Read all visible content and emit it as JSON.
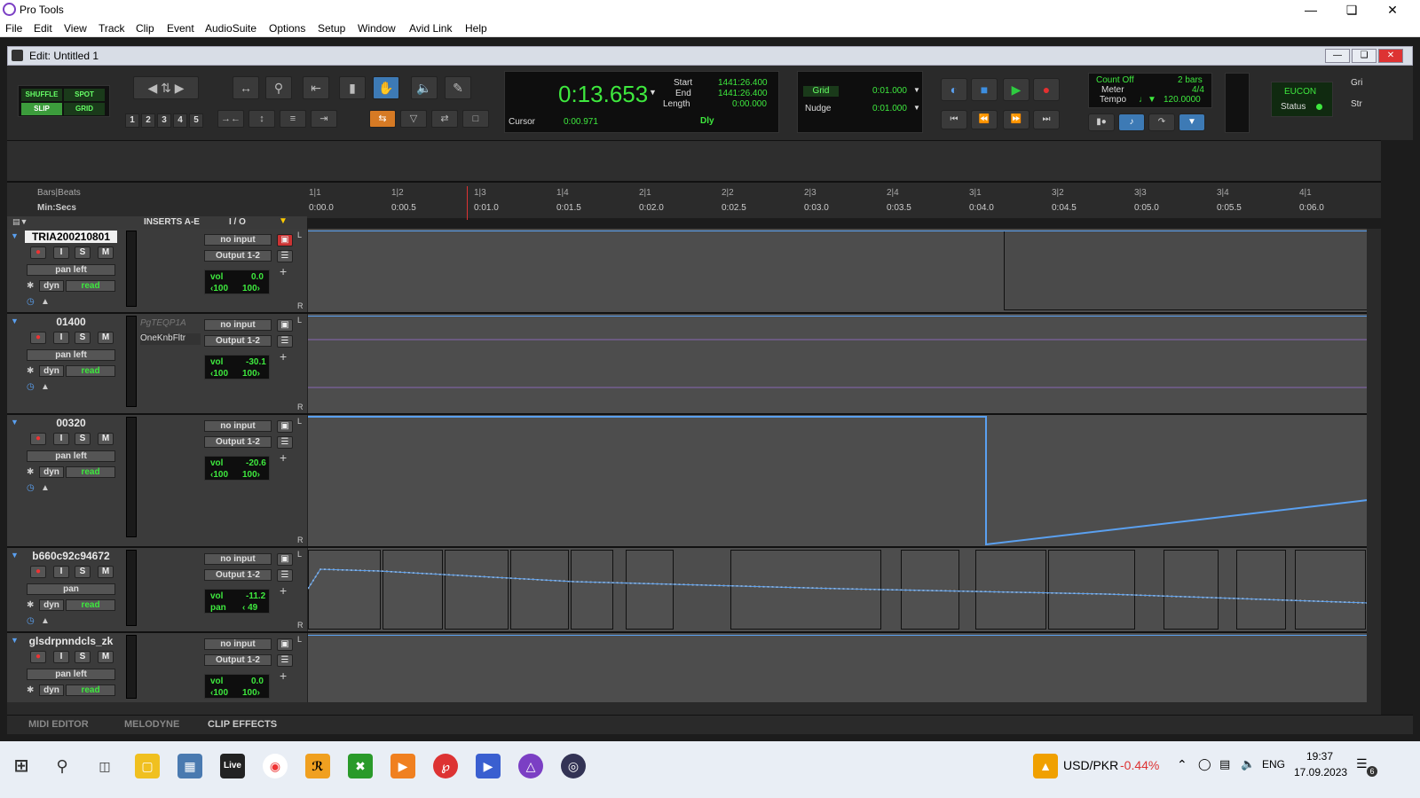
{
  "app": {
    "title": "Pro Tools"
  },
  "menu": [
    "File",
    "Edit",
    "View",
    "Track",
    "Clip",
    "Event",
    "AudioSuite",
    "Options",
    "Setup",
    "Window",
    "Avid Link",
    "Help"
  ],
  "edit_window": {
    "title": "Edit: Untitled 1"
  },
  "modes": {
    "shuffle": "SHUFFLE",
    "spot": "SPOT",
    "slip": "SLIP",
    "grid": "GRID"
  },
  "zoom_presets": [
    "1",
    "2",
    "3",
    "4",
    "5"
  ],
  "counter": {
    "main": "0:13.653",
    "start_label": "Start",
    "start": "1441:26.400",
    "end_label": "End",
    "end": "1441:26.400",
    "length_label": "Length",
    "length": "0:00.000",
    "cursor_label": "Cursor",
    "cursor": "0:00.971",
    "dly": "Dly"
  },
  "grid": {
    "grid_label": "Grid",
    "grid_value": "0:01.000",
    "nudge_label": "Nudge",
    "nudge_value": "0:01.000"
  },
  "countoff": {
    "label": "Count Off",
    "bars": "2 bars",
    "meter_label": "Meter",
    "meter": "4/4",
    "tempo_label": "Tempo",
    "tempo": "120.0000"
  },
  "eucon": {
    "label": "EUCON",
    "status": "Status"
  },
  "misc": {
    "gri": "Gri",
    "str": "Str"
  },
  "rulers": {
    "bars_label": "Bars|Beats",
    "min_label": "Min:Secs",
    "bars": [
      "1|1",
      "1|2",
      "1|3",
      "1|4",
      "2|1",
      "2|2",
      "2|3",
      "2|4",
      "3|1",
      "3|2",
      "3|3",
      "3|4",
      "4|1"
    ],
    "secs": [
      "0:00.0",
      "0:00.5",
      "0:01.0",
      "0:01.5",
      "0:02.0",
      "0:02.5",
      "0:03.0",
      "0:03.5",
      "0:04.0",
      "0:04.5",
      "0:05.0",
      "0:05.5",
      "0:06.0"
    ]
  },
  "columns": {
    "inserts": "INSERTS A-E",
    "io": "I / O"
  },
  "tracks": [
    {
      "name": "TRIA200210801",
      "insert1": "",
      "insert2": "",
      "input": "no input",
      "output": "Output 1-2",
      "pan_mode": "pan left",
      "dyn": "dyn",
      "auto": "read",
      "vol_label": "vol",
      "vol": "0.0",
      "p1": "‹100",
      "p2": "100›"
    },
    {
      "name": "01400",
      "insert1": "PgTEQP1A",
      "insert2": "OneKnbFltr",
      "input": "no input",
      "output": "Output 1-2",
      "pan_mode": "pan left",
      "dyn": "dyn",
      "auto": "read",
      "vol_label": "vol",
      "vol": "-30.1",
      "p1": "‹100",
      "p2": "100›"
    },
    {
      "name": "00320",
      "insert1": "",
      "insert2": "",
      "input": "no input",
      "output": "Output 1-2",
      "pan_mode": "pan left",
      "dyn": "dyn",
      "auto": "read",
      "vol_label": "vol",
      "vol": "-20.6",
      "p1": "‹100",
      "p2": "100›"
    },
    {
      "name": "b660c92c94672",
      "insert1": "",
      "insert2": "",
      "input": "no input",
      "output": "Output 1-2",
      "pan_mode": "pan",
      "dyn": "dyn",
      "auto": "read",
      "vol_label": "vol",
      "vol": "-11.2",
      "p1": "pan",
      "p2": "‹ 49"
    },
    {
      "name": "glsdrpnndcls_zk",
      "insert1": "",
      "insert2": "",
      "input": "no input",
      "output": "Output 1-2",
      "pan_mode": "pan left",
      "dyn": "dyn",
      "auto": "read",
      "vol_label": "vol",
      "vol": "0.0",
      "p1": "‹100",
      "p2": "100›"
    }
  ],
  "button_labels": {
    "input": "I",
    "solo": "S",
    "mute": "M"
  },
  "lane_labels": {
    "left": "L",
    "right": "R"
  },
  "bottom_tabs": [
    "MIDI EDITOR",
    "MELODYNE",
    "CLIP EFFECTS"
  ],
  "taskbar": {
    "live": "Live",
    "ticker": "USD/PKR",
    "change": "-0.44%",
    "lang": "ENG",
    "time": "19:37",
    "date": "17.09.2023",
    "notif": "6"
  },
  "colors": {
    "accent_blue": "#3d7ab5",
    "counter_green": "#3ee83e",
    "play_green": "#2ecc40",
    "record_red": "#e53030",
    "auto_line": "#5aa0f0"
  }
}
